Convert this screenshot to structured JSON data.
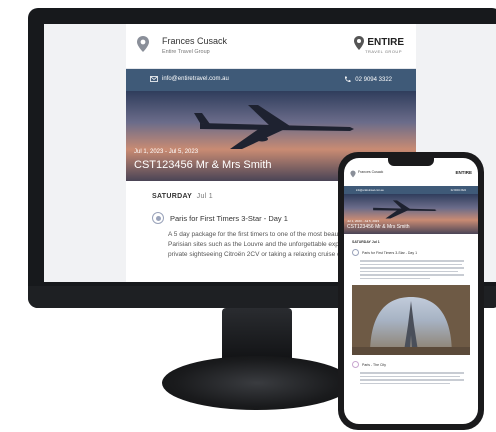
{
  "email": {
    "agent_name": "Frances Cusack",
    "agent_company": "Entire Travel Group",
    "brand": "ENTIRE",
    "brand_sub": "TRAVEL GROUP",
    "contact_email": "info@entiretravel.com.au",
    "contact_phone": "02 9094 3322",
    "hero_dates": "Jul 1, 2023 - Jul 5, 2023",
    "hero_title": "CST123456 Mr & Mrs Smith",
    "day_label": "SATURDAY",
    "day_date": "Jul 1",
    "tour_title": "Paris for First Timers 3-Star - Day 1",
    "tour_desc": "A 5 day package for the first timers to one of the most beautiful including some iconic Parisian sites such as the Louvre and the unforgettable experiences such as your own private sightseeing Citroën 2CV or taking a relaxing cruise down the Seine."
  },
  "phone": {
    "agent_name": "Frances Cusack",
    "brand": "ENTIRE",
    "contact_email": "info@entiretravel.com.au",
    "contact_phone": "02 9094 3322",
    "hero_dates": "Jul 1, 2023 - Jul 5, 2023",
    "hero_title": "CST123456 Mr & Mrs Smith",
    "day_label": "SATURDAY Jul 1",
    "tour_title": "Paris for First Timers 3-Star - Day 1",
    "tour2_title": "Paris - The City"
  },
  "colors": {
    "contact_bar": "#3f5a78",
    "bezel": "#17191c",
    "accent_dot": "#9aa3ba"
  }
}
